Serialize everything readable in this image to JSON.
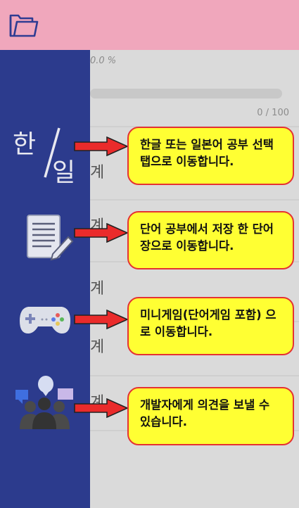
{
  "toolbar": {
    "folder_icon": "folder-icon"
  },
  "background": {
    "percent_text": "0.0 %",
    "count_text": "0 / 100",
    "word_suffix": "계"
  },
  "sidebar": {
    "items": [
      {
        "icon": "hangul-japanese-toggle-icon",
        "icon_top": "한",
        "icon_bottom": "일",
        "tooltip": "한글 또는 일본어 공부 선택 탭으로 이동합니다."
      },
      {
        "icon": "notepad-pencil-icon",
        "tooltip": "단어 공부에서 저장 한 단어장으로 이동합니다."
      },
      {
        "icon": "gamepad-icon",
        "tooltip": "미니게임(단어게임 포함) 으로 이동합니다."
      },
      {
        "icon": "feedback-people-icon",
        "tooltip": "개발자에게 의견을 보낼 수 있습니다."
      }
    ]
  },
  "colors": {
    "topbar": "#f0a7bc",
    "sidebar": "#2c3b8d",
    "callout_bg": "#ffff33",
    "callout_border": "#e53232"
  }
}
